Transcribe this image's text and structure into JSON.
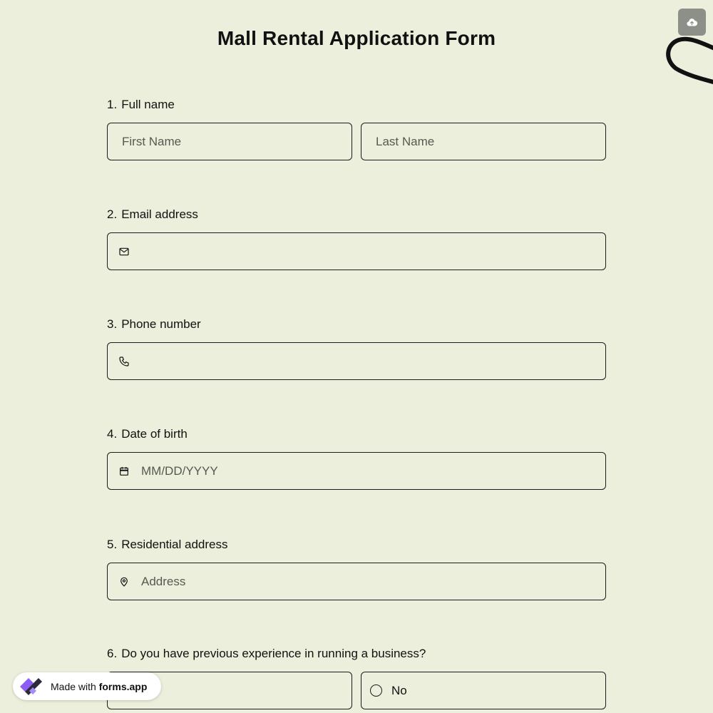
{
  "form": {
    "title": "Mall Rental Application Form"
  },
  "questions": {
    "q1": {
      "number": "1.",
      "label": "Full name",
      "first_placeholder": "First Name",
      "last_placeholder": "Last Name"
    },
    "q2": {
      "number": "2.",
      "label": "Email address",
      "icon": "mail-icon"
    },
    "q3": {
      "number": "3.",
      "label": "Phone number",
      "icon": "phone-icon"
    },
    "q4": {
      "number": "4.",
      "label": "Date of birth",
      "placeholder": "MM/DD/YYYY",
      "icon": "calendar-icon"
    },
    "q5": {
      "number": "5.",
      "label": "Residential address",
      "placeholder": "Address",
      "icon": "location-pin-icon"
    },
    "q6": {
      "number": "6.",
      "label": "Do you have previous experience in running a business?",
      "options": [
        "",
        "No"
      ]
    }
  },
  "badge": {
    "prefix": "Made with",
    "brand": "forms.app"
  },
  "toolbar": {
    "upload_icon": "cloud-upload-icon"
  },
  "colors": {
    "background": "#ebefdb",
    "border": "#1c1c1c",
    "text": "#111111",
    "upload_button": "#8d8f89",
    "badge_background": "#ffffff",
    "logo_purple": "#8b5cf6",
    "logo_dark": "#2a2a3a"
  }
}
